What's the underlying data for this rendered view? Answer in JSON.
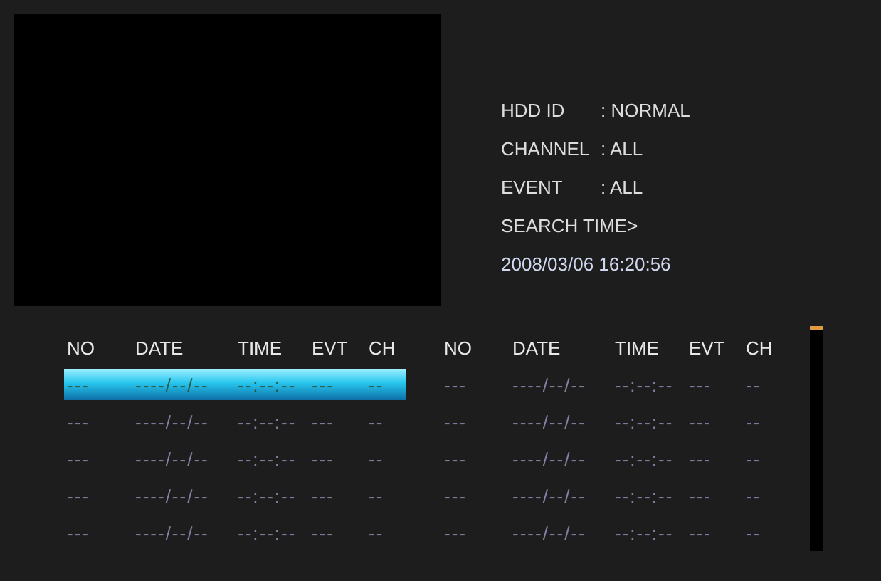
{
  "info": [
    {
      "label": "HDD ID",
      "value": ": NORMAL"
    },
    {
      "label": "CHANNEL",
      "value": ": ALL"
    },
    {
      "label": "EVENT",
      "value": ": ALL"
    }
  ],
  "search_time": {
    "label": "SEARCH TIME>",
    "value": "2008/03/06  16:20:56"
  },
  "tables": [
    {
      "columns": [
        "NO",
        "DATE",
        "TIME",
        "EVT",
        "CH"
      ],
      "rows": [
        {
          "selected": true,
          "cells": [
            "---",
            "----/--/--",
            "--:--:--",
            "---",
            "--"
          ]
        },
        {
          "selected": false,
          "cells": [
            "---",
            "----/--/--",
            "--:--:--",
            "---",
            "--"
          ]
        },
        {
          "selected": false,
          "cells": [
            "---",
            "----/--/--",
            "--:--:--",
            "---",
            "--"
          ]
        },
        {
          "selected": false,
          "cells": [
            "---",
            "----/--/--",
            "--:--:--",
            "---",
            "--"
          ]
        },
        {
          "selected": false,
          "cells": [
            "---",
            "----/--/--",
            "--:--:--",
            "---",
            "--"
          ]
        }
      ]
    },
    {
      "columns": [
        "NO",
        "DATE",
        "TIME",
        "EVT",
        "CH"
      ],
      "rows": [
        {
          "selected": false,
          "cells": [
            "---",
            "----/--/--",
            "--:--:--",
            "---",
            "--"
          ]
        },
        {
          "selected": false,
          "cells": [
            "---",
            "----/--/--",
            "--:--:--",
            "---",
            "--"
          ]
        },
        {
          "selected": false,
          "cells": [
            "---",
            "----/--/--",
            "--:--:--",
            "---",
            "--"
          ]
        },
        {
          "selected": false,
          "cells": [
            "---",
            "----/--/--",
            "--:--:--",
            "---",
            "--"
          ]
        },
        {
          "selected": false,
          "cells": [
            "---",
            "----/--/--",
            "--:--:--",
            "---",
            "--"
          ]
        }
      ]
    }
  ]
}
